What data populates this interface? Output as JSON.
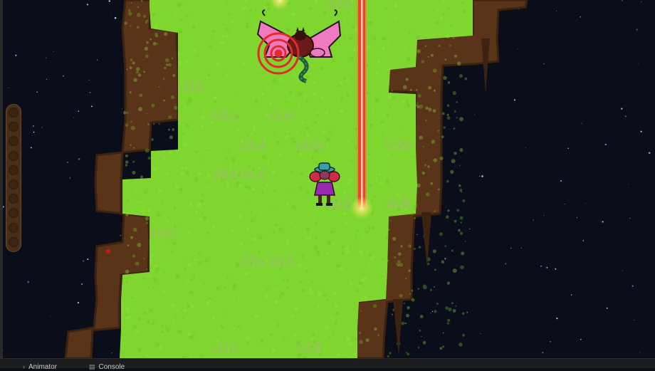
{
  "game": {
    "stamina": {
      "total": 10,
      "filled": 0
    },
    "colors": {
      "grass": "#7fd62f",
      "grass_tuft": "#9fb86a",
      "dirt": "#5a3418",
      "dirt_dark": "#3e2210",
      "space": "#0a0e1a",
      "laser": "#ff3a2a",
      "laser_core": "#ffe0c0",
      "target_ring": "#e32a2a"
    },
    "player": {
      "name_icon": "witch-player-sprite"
    },
    "enemy": {
      "name_icon": "winged-serpent-boss-sprite"
    }
  },
  "bottom_panel": {
    "tabs": [
      {
        "icon": "›",
        "label": "Animator"
      },
      {
        "icon": "▤",
        "label": "Console"
      }
    ]
  }
}
